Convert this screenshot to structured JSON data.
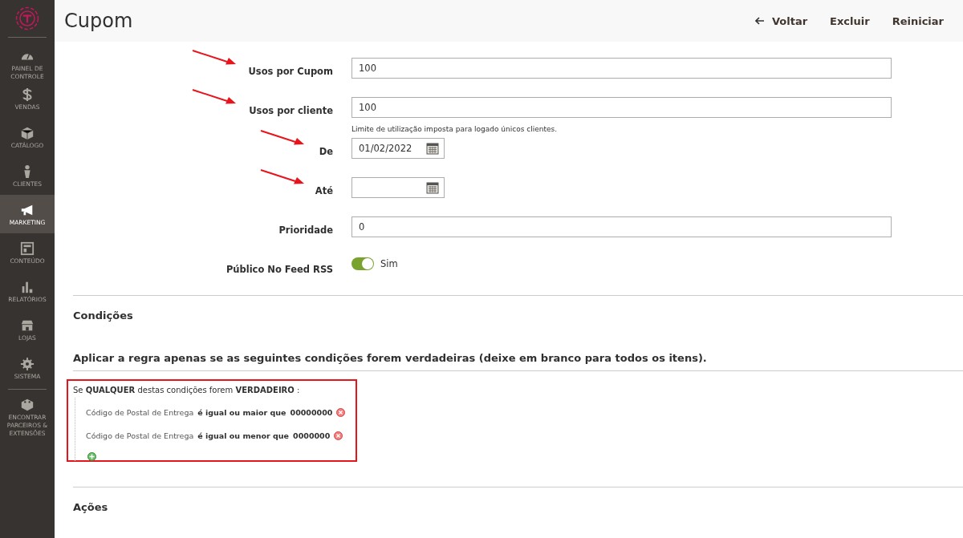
{
  "sidebar": {
    "items": [
      {
        "label": "PAINEL DE CONTROLE",
        "selected": false
      },
      {
        "label": "VENDAS",
        "selected": false
      },
      {
        "label": "CATÁLOGO",
        "selected": false
      },
      {
        "label": "CLIENTES",
        "selected": false
      },
      {
        "label": "MARKETING",
        "selected": true
      },
      {
        "label": "CONTEÚDO",
        "selected": false
      },
      {
        "label": "RELATÓRIOS",
        "selected": false
      },
      {
        "label": "LOJAS",
        "selected": false
      },
      {
        "label": "SISTEMA",
        "selected": false
      },
      {
        "label": "ENCONTRAR PARCEIROS & EXTENSÕES",
        "selected": false
      }
    ]
  },
  "header": {
    "title": "Cupom",
    "actions": [
      {
        "label": "Voltar",
        "kind": "back"
      },
      {
        "label": "Excluir",
        "kind": "plain"
      },
      {
        "label": "Reiniciar",
        "kind": "plain"
      }
    ]
  },
  "fields": [
    {
      "kind": "text",
      "label": "Usos por Cupom",
      "value": "100",
      "annotated": true
    },
    {
      "kind": "text",
      "label": "Usos por cliente",
      "value": "100",
      "note": "Limite de utilização imposta para logado únicos clientes.",
      "annotated": true
    },
    {
      "kind": "date",
      "label": "De",
      "value": "01/02/2022",
      "annotated": true
    },
    {
      "kind": "date",
      "label": "Até",
      "annotated": true
    },
    {
      "kind": "text",
      "label": "Prioridade",
      "value": "0",
      "annotated": false
    },
    {
      "kind": "toggle",
      "label": "Público No Feed RSS",
      "on": true,
      "state_label": "Sim",
      "annotated": false
    }
  ],
  "conditions": {
    "title": "Condições",
    "heading": "Aplicar a regra apenas se as seguintes condições forem verdadeiras (deixe em branco para todos os itens).",
    "highlighted": true,
    "summary": "Se **QUALQUER**  destas condições forem **VERDADEIRO** :",
    "rules": [
      {
        "attribute": "Código de Postal de Entrega",
        "operator": "é igual ou maior que",
        "value": "00000000"
      },
      {
        "attribute": "Código de Postal de Entrega",
        "operator": "é igual ou menor que",
        "value": "0000000"
      }
    ]
  },
  "actions_section": {
    "title": "Ações"
  }
}
